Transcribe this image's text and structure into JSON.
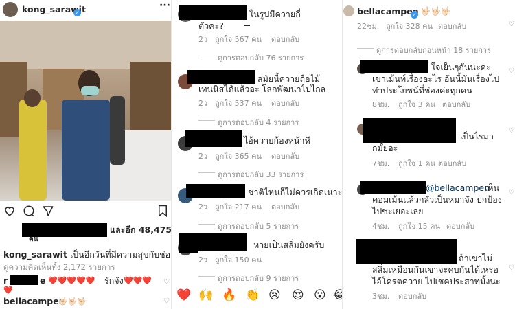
{
  "colors": {
    "link": "#3897f0",
    "muted": "#8e8e8e",
    "redaction": "#000000",
    "heart": "#e0245e"
  },
  "panel1": {
    "username": "kong_sarawit",
    "more_icon": "more-horizontal-icon",
    "likes_suffix": "และอีก 48,475",
    "likes_overflow": "คน",
    "caption_user": "kong_sarawit",
    "caption_text": "เป็นอีกวันที่มีความสุขกับช่อง3",
    "view_comments": "ดูความคิดเห็นทั้ง 2,172 รายการ",
    "comment1_prefix": "r",
    "comment1_suffix": "e",
    "comment1_hearts_a": "❤️❤️❤️❤️❤️",
    "comment1_text": "รักจัง",
    "comment1_hearts_b": "❤️❤️❤️",
    "comment1_overflow": "❤️",
    "comment2_user": "bellacampen",
    "comment2_emoji": "🤟🏻🤟🏻🤟🏻"
  },
  "panel2": {
    "c1": {
      "text_a": "ในรูปมีควายกี่",
      "text_b": "ตัวคะ?",
      "time": "2ว",
      "likes": "ถูกใจ 567 คน",
      "reply": "ตอบกลับ",
      "view_replies": "ดูการตอบกลับ 76 รายการ"
    },
    "c2": {
      "text_a": "สมัยนี้ควายถือไม้",
      "text_b": "เทนนิสได้แล้วอะ โลกพัฒนาไปไกล",
      "time": "2ว",
      "likes": "ถูกใจ 537 คน",
      "reply": "ตอบกลับ",
      "view_replies": "ดูการตอบกลับ 4 รายการ"
    },
    "c3": {
      "text_a": "ไอ้ควายก้องหน้าหี",
      "time": "2ว",
      "likes": "ถูกใจ 365 คน",
      "reply": "ตอบกลับ",
      "view_replies": "ดูการตอบกลับ 33 รายการ"
    },
    "c4": {
      "text_a": "ชาติไหนก็ไม่ควรเกิดเนาะ",
      "time": "2ว",
      "likes": "ถูกใจ 217 คน",
      "reply": "ตอบกลับ",
      "view_replies": "ดูการตอบกลับ 5 รายการ"
    },
    "c5": {
      "text_a": "หายเป็นสลิ่มยังครับ",
      "time": "2ว",
      "likes": "ถูกใจ 150 คน",
      "view_replies": "ดูการตอบกลับ 9 รายการ"
    },
    "emoji_bar": [
      "❤️",
      "🙌",
      "🔥",
      "👏",
      "😢",
      "😍",
      "😮",
      "😂"
    ]
  },
  "panel3": {
    "user": "bellacampen",
    "user_emoji": "🤟🏻🤟🏻🤟🏻",
    "time": "22ชม.",
    "likes": "ถูกใจ 328 คน",
    "reply": "ตอบกลับ",
    "prev_replies": "ดูการตอบกลับก่อนหน้า 18 รายการ",
    "r1": {
      "text_a": "ใจเย็นๆกันนะคะ",
      "text_b": "เขาเม้นท์เรื่องอะไร อันนี้มันเรื่องไป",
      "text_c": "ทำประโยชน์ที่ช่องค่ะทุกคน",
      "time": "8ชม.",
      "likes": "ถูกใจ 3 คน",
      "reply": "ตอบกลับ"
    },
    "r2": {
      "text_a": "เป็นไรมา",
      "text_b": "กมั้ยอะ",
      "time": "7ชม.",
      "likes": "ถูกใจ 1 คน",
      "reply": "ตอบกลับ"
    },
    "r3": {
      "mention": "@bellacampen",
      "text_a": "เห็น",
      "text_b": "คอมเม้นแล้วกลัวเป็นหมาจัง ปกป้อง",
      "text_c": "ไปซะเยอะเลย",
      "time": "4ชม.",
      "likes": "ถูกใจ 15 คน",
      "reply": "ตอบกลับ"
    },
    "r4": {
      "text_a": "ถ้าเขาไม่",
      "text_b": "สลิ่มเหมือนกันเขาจะคบกันได้เหรอ",
      "text_c": "ไอ้โครตควาย ไปเชคประสาทมั้งนะ",
      "time": "3ชม.",
      "reply": "ตอบกลับ"
    }
  }
}
